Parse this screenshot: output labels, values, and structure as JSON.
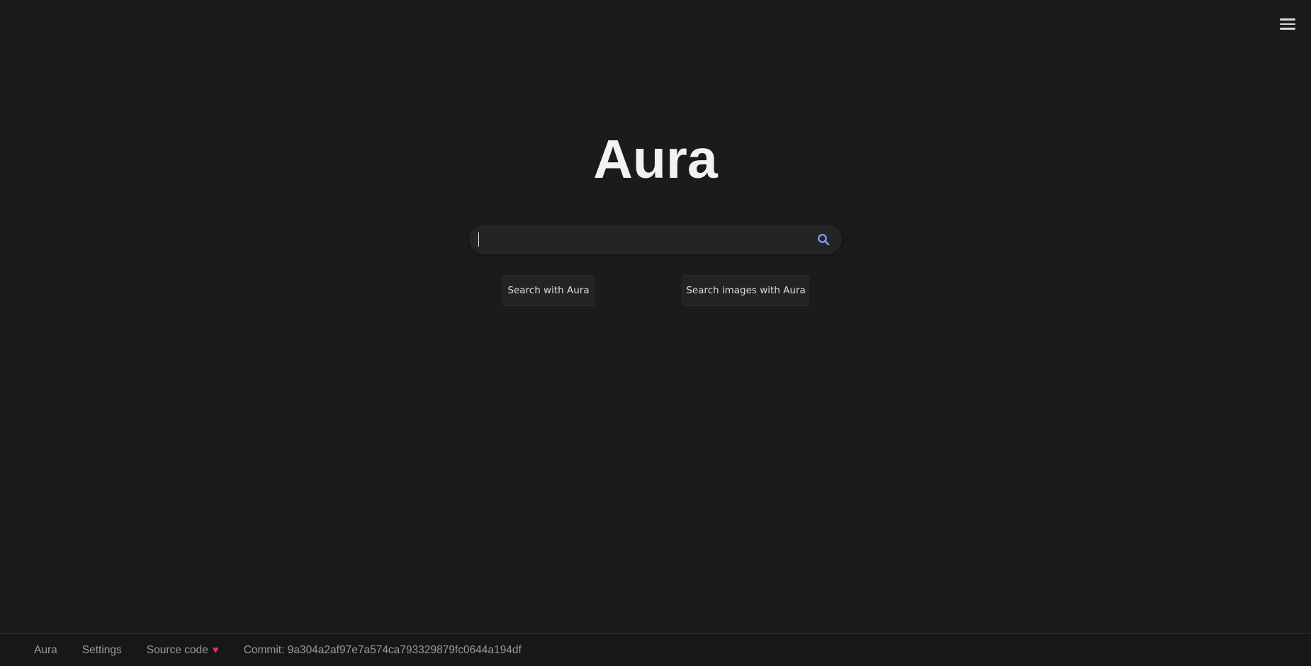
{
  "header": {
    "menu_icon": "hamburger-menu-icon"
  },
  "main": {
    "logo_text": "Aura",
    "search": {
      "value": "",
      "placeholder": "",
      "icon": "search-icon",
      "icon_color": "#7da6ff"
    },
    "buttons": {
      "search_label": "Search with Aura",
      "images_label": "Search images with Aura"
    }
  },
  "footer": {
    "links": {
      "home": "Aura",
      "settings": "Settings",
      "source": "Source code"
    },
    "heart_glyph": "♥",
    "heart_color": "#e0334a",
    "commit": "Commit: 9a304a2af97e7a574ca793329879fc0644a194df"
  },
  "colors": {
    "background": "#1b1b1b",
    "footer_background": "#171717",
    "text": "#e6e6e6",
    "muted_text": "#9a9a9a"
  }
}
